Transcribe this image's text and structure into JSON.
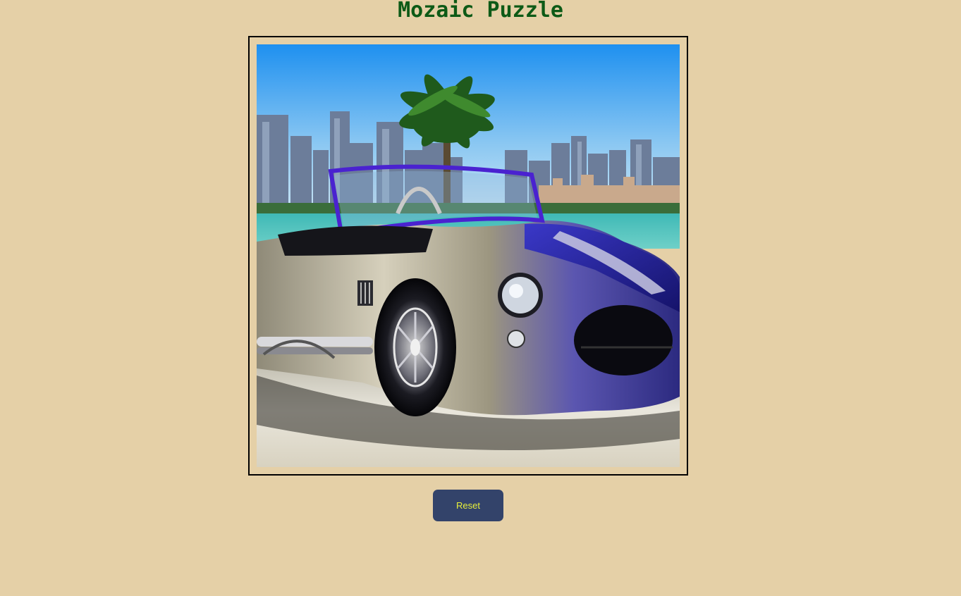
{
  "page": {
    "title": "Mozaic Puzzle"
  },
  "puzzle": {
    "grid_rows": 4,
    "grid_cols": 4,
    "image_subject": "blue and silver convertible roadster parked by the water with a palm tree and city skyline behind",
    "solved": true
  },
  "controls": {
    "reset_label": "Reset"
  },
  "colors": {
    "background": "#e5d0a7",
    "title": "#0d5a16",
    "button_bg": "#33436a",
    "button_text": "#e8f03a",
    "frame_border": "#000000"
  }
}
